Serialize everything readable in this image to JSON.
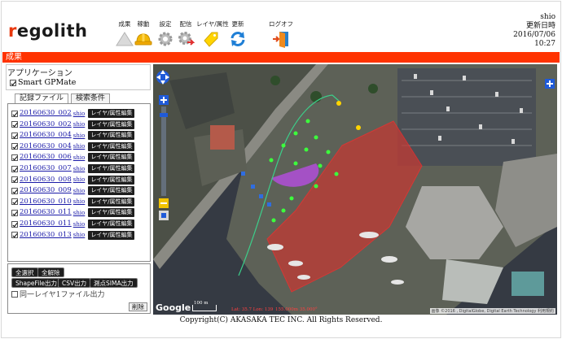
{
  "header": {
    "logo_prefix": "r",
    "logo_rest": "egolith",
    "toolbar": [
      {
        "label": "成果",
        "icon": "triangle-icon"
      },
      {
        "label": "稼動",
        "icon": "hardhat-icon"
      },
      {
        "label": "設定",
        "icon": "gear-icon"
      },
      {
        "label": "配信",
        "icon": "gear-arrow-icon"
      },
      {
        "label": "レイヤ/属性",
        "icon": "tag-icon"
      },
      {
        "label": "更新",
        "icon": "refresh-icon"
      },
      {
        "label": "ログオフ",
        "icon": "door-exit-icon"
      }
    ],
    "user": "shio",
    "updated_label": "更新日時",
    "updated_date": "2016/07/06",
    "updated_time": "10:27"
  },
  "title_bar": {
    "label": "成果"
  },
  "sidebar": {
    "app_title": "アプリケーション",
    "app_name": "Smart GPMate",
    "app_checked": true,
    "tabs": [
      {
        "label": "記録ファイル",
        "active": true
      },
      {
        "label": "検索条件",
        "active": false
      }
    ],
    "files": [
      {
        "name": "20160630_002",
        "user": "shio",
        "button": "レイヤ/属性編集",
        "checked": true
      },
      {
        "name": "20160630_002",
        "user": "shio",
        "button": "レイヤ/属性編集",
        "checked": true
      },
      {
        "name": "20160630_004",
        "user": "shio",
        "button": "レイヤ/属性編集",
        "checked": true
      },
      {
        "name": "20160630_004",
        "user": "shio",
        "button": "レイヤ/属性編集",
        "checked": true
      },
      {
        "name": "20160630_006",
        "user": "shio",
        "button": "レイヤ/属性編集",
        "checked": true
      },
      {
        "name": "20160630_007",
        "user": "shio",
        "button": "レイヤ/属性編集",
        "checked": true
      },
      {
        "name": "20160630_008",
        "user": "shio",
        "button": "レイヤ/属性編集",
        "checked": true
      },
      {
        "name": "20160630_009",
        "user": "shio",
        "button": "レイヤ/属性編集",
        "checked": true
      },
      {
        "name": "20160630_010",
        "user": "shio",
        "button": "レイヤ/属性編集",
        "checked": true
      },
      {
        "name": "20160630_011",
        "user": "shio",
        "button": "レイヤ/属性編集",
        "checked": true
      },
      {
        "name": "20160630_011",
        "user": "shio",
        "button": "レイヤ/属性編集",
        "checked": true
      },
      {
        "name": "20160630_013",
        "user": "shio",
        "button": "レイヤ/属性編集",
        "checked": true
      }
    ],
    "select_all": "全選択",
    "deselect_all": "全解除",
    "shapefile_out": "ShapeFile出力",
    "csv_out": "CSV出力",
    "sima_out": "測点SIMA出力",
    "same_layer": "同一レイヤ1ファイル出力",
    "same_layer_checked": false,
    "delete": "削除"
  },
  "map": {
    "google_label": "Google",
    "bottom_text_1": "100 m",
    "bottom_text_2": "Lat: 35.7 Lon: 139",
    "bottom_text_3": "155.000m  35.000°",
    "attribution": "画像 ©2016 , DigitalGlobe, Digital Earth Technology  利用規約"
  },
  "footer": {
    "copyright": "Copyright(C) AKASAKA TEC INC. All Rights Reserved."
  }
}
